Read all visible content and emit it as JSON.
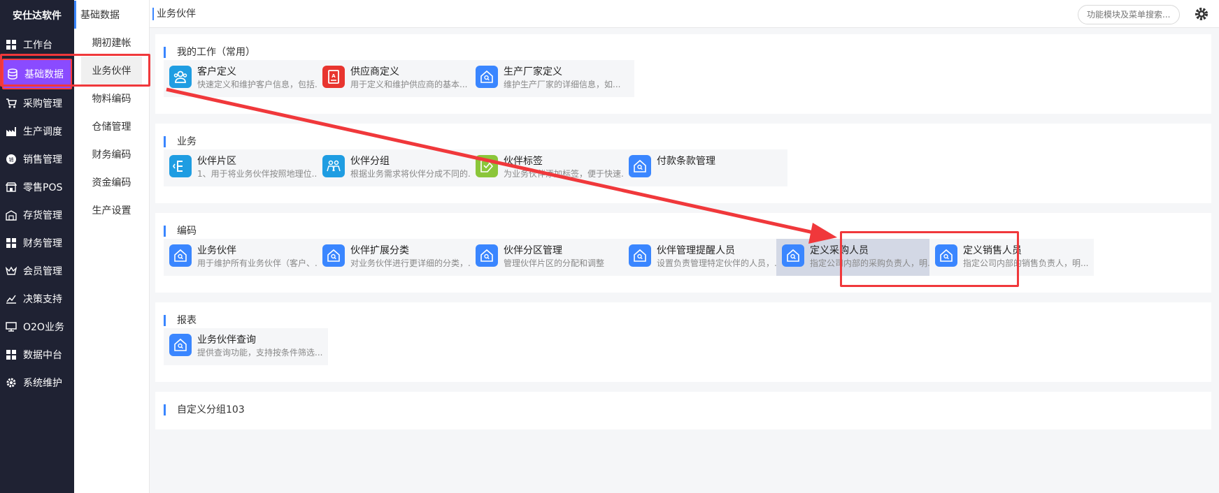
{
  "sidebar": {
    "brand": "安仕达软件",
    "items": [
      {
        "label": "工作台",
        "icon": "grid-icon"
      },
      {
        "label": "基础数据",
        "icon": "database-icon"
      },
      {
        "label": "采购管理",
        "icon": "cart-icon"
      },
      {
        "label": "生产调度",
        "icon": "factory-icon"
      },
      {
        "label": "销售管理",
        "icon": "sales-icon"
      },
      {
        "label": "零售POS",
        "icon": "pos-icon"
      },
      {
        "label": "存货管理",
        "icon": "warehouse-icon"
      },
      {
        "label": "财务管理",
        "icon": "grid-icon"
      },
      {
        "label": "会员管理",
        "icon": "crown-icon"
      },
      {
        "label": "决策支持",
        "icon": "chart-icon"
      },
      {
        "label": "O2O业务",
        "icon": "monitor-icon"
      },
      {
        "label": "数据中台",
        "icon": "grid-icon"
      },
      {
        "label": "系统维护",
        "icon": "gear-icon"
      }
    ]
  },
  "subbar": {
    "title": "基础数据",
    "items": [
      "期初建帐",
      "业务伙伴",
      "物料编码",
      "仓储管理",
      "财务编码",
      "资金编码",
      "生产设置"
    ]
  },
  "header": {
    "breadcrumb": "业务伙伴",
    "search_placeholder": "功能模块及菜单搜索..."
  },
  "sections": {
    "common": {
      "title": "我的工作（常用）",
      "cards": [
        {
          "name": "客户定义",
          "desc": "快速定义和维护客户信息，包括...",
          "icon": "customer-icon",
          "color": "#1f9de2"
        },
        {
          "name": "供应商定义",
          "desc": "用于定义和维护供应商的基本...",
          "icon": "supplier-icon",
          "color": "#e8352f"
        },
        {
          "name": "生产厂家定义",
          "desc": "维护生产厂家的详细信息，如...",
          "icon": "home-icon",
          "color": "#3a86ff"
        }
      ]
    },
    "business": {
      "title": "业务",
      "cards": [
        {
          "name": "伙伴片区",
          "desc": "1、用于将业务伙伴按照地理位...",
          "icon": "region-icon",
          "color": "#1f9de2"
        },
        {
          "name": "伙伴分组",
          "desc": "根据业务需求将伙伴分成不同的...",
          "icon": "group-icon",
          "color": "#1f9de2"
        },
        {
          "name": "伙伴标签",
          "desc": "为业务伙伴添加标签，便于快速...",
          "icon": "tag-icon",
          "color": "#8bc63a"
        },
        {
          "name": "付款条款管理",
          "desc": "",
          "icon": "home-icon",
          "color": "#3a86ff"
        }
      ]
    },
    "coding": {
      "title": "编码",
      "cards": [
        {
          "name": "业务伙伴",
          "desc": "用于维护所有业务伙伴（客户、...",
          "icon": "home-icon",
          "color": "#3a86ff"
        },
        {
          "name": "伙伴扩展分类",
          "desc": "对业务伙伴进行更详细的分类，...",
          "icon": "home-icon",
          "color": "#3a86ff"
        },
        {
          "name": "伙伴分区管理",
          "desc": "管理伙伴片区的分配和调整",
          "icon": "home-icon",
          "color": "#3a86ff"
        },
        {
          "name": "伙伴管理提醒人员",
          "desc": "设置负责管理特定伙伴的人员，...",
          "icon": "home-icon",
          "color": "#3a86ff"
        },
        {
          "name": "定义采购人员",
          "desc": "指定公司内部的采购负责人，明...",
          "icon": "home-icon",
          "color": "#3a86ff"
        },
        {
          "name": "定义销售人员",
          "desc": "指定公司内部的销售负责人，明...",
          "icon": "home-icon",
          "color": "#3a86ff"
        }
      ]
    },
    "report": {
      "title": "报表",
      "cards": [
        {
          "name": "业务伙伴查询",
          "desc": "提供查询功能，支持按条件筛选...",
          "icon": "home-icon",
          "color": "#3a86ff"
        }
      ]
    },
    "custom": {
      "title": "自定义分组103"
    }
  },
  "colors": {
    "sidebar_bg": "#1f2233",
    "active_nav": "#8a4bff",
    "accent": "#3a86ff",
    "annotation_red": "#f0383b"
  }
}
